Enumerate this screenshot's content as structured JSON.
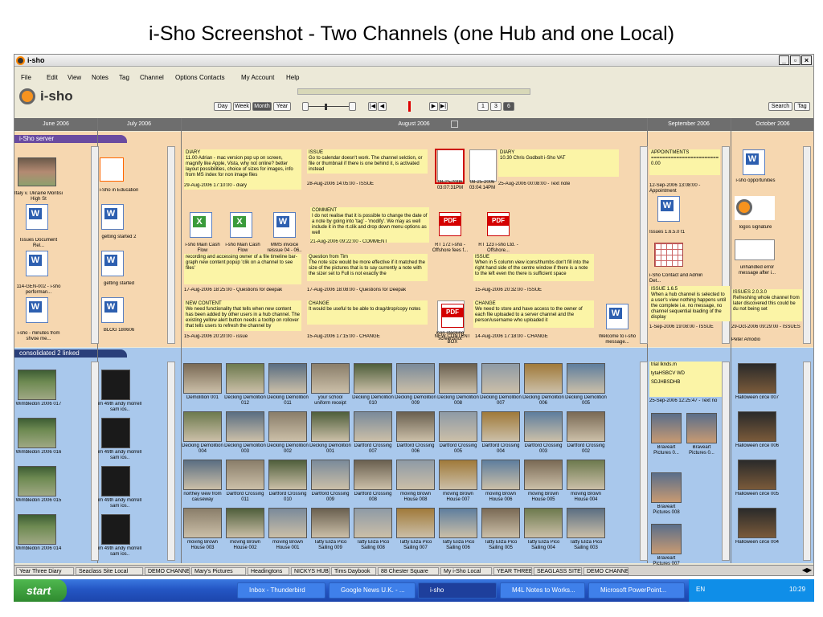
{
  "slide_title": "i-Sho Screenshot -  Two Channels (one Hub and one Local)",
  "window": {
    "title": "i-sho"
  },
  "menu": [
    "File",
    "Edit",
    "View",
    "Notes",
    "Tag",
    "Channel",
    "Options",
    "Contacts",
    "My Account",
    "Help"
  ],
  "toolbar": {
    "logo": "i-sho",
    "view_buttons": [
      "Day",
      "Week",
      "Month",
      "Year"
    ],
    "page_buttons": [
      "1",
      "3",
      "6"
    ],
    "search_label": "Search",
    "tag_label": "Tag"
  },
  "months": [
    "June 2006",
    "July 2006",
    "August 2006",
    "September 2006",
    "October 2006"
  ],
  "top_channel": {
    "name": "i-Sho server",
    "june_items": [
      "Italy v. Ukraine Montisi High St",
      "Issues Document Rel...",
      "114-GEN-002 - i-sho performan...",
      "i-sho - minutes from shvoe me..."
    ],
    "july_items": [
      "i-Sho in Education",
      "getting started 2",
      "getting started",
      "BLOG 180606"
    ],
    "notes": [
      {
        "title": "DIARY",
        "body": "11.00 Adrian - mac version pop up on screen, magnify like Apple, Vista, why not online? better layout possibilities, choice of sizes for images, info from MS index for non image files",
        "footer": "29-Aug-2006 17:10:00 - diary"
      },
      {
        "title": "ISSUE",
        "body": "Go to calendar doesn't work. The channel selction, or file or thumbnail if there is one behind it, is activated instead",
        "footer": "28-Aug-2006 14:05:00 - ISSUE"
      },
      {
        "title": "DIARY",
        "body": "10.30 Chris Godbolt i-Sho VAT",
        "footer": "25-Aug-2006 00:08:00 - Text note"
      },
      {
        "title": "COMMENT",
        "body": "I do not realise that it is possible to change the date of a note by going into 'tag' - 'modify'. We may as well include it in the rt.clik and drop down menu options as well",
        "footer": "21-Aug-2006 09:22:00 - COMMENT"
      },
      {
        "title": "",
        "body": "recording and accessing owner of a file timeline bar-graph new content popup 'clik on a channel to see files'",
        "footer": "17-Aug-2006 18:25:00 - Questions for deepak"
      },
      {
        "title": "Question from Tim",
        "body": "The note size would be more effective if it matched the size of the pictures that is to say currently a note with the sizer set to Full is not exactly the",
        "footer": "17-Aug-2006 18:08:00 - Questions for Deepak"
      },
      {
        "title": "ISSUE",
        "body": "When in 5 column view icons/thumbs don't fill into the right hand side of the centre window if there is a note to the left even tho there is sufficient space",
        "footer": "15-Aug-2006 20:32:00 - ISSUE"
      },
      {
        "title": "NEW CONTENT",
        "body": "We need functionality that tells when new content has been added by other users in a hub channel. The existing yellow alert button needs a tooltip on rollover that tells users to refresh the channel by",
        "footer": "15-Aug-2006 20:20:00 - issue"
      },
      {
        "title": "CHANGE",
        "body": "It would be useful to be able to drag/drop/copy notes",
        "footer": "15-Aug-2006 17:15:00 - CHANGE"
      },
      {
        "title": "CHANGE",
        "body": "We need to store and have access to the owner of each file uploaded to a server channel and the person/username who uploaded it",
        "footer": "14-Aug-2006 17:18:00 - CHANGE"
      }
    ],
    "aug_files": [
      {
        "label": "08-25-2006 03:07:31PM",
        "kind": "shot"
      },
      {
        "label": "08-25-2006 03:04:14PM",
        "kind": "shot"
      },
      {
        "label": "i-sho Main Cash Flow",
        "kind": "xls"
      },
      {
        "label": "i-sho Main Cash Flow",
        "kind": "xls"
      },
      {
        "label": "MMS invoice reissue 04 - 06..",
        "kind": "doc"
      },
      {
        "label": "RT 172 i-sho - Offshore fees f...",
        "kind": "pdf"
      },
      {
        "label": "RT 123 i-sho Ltd. - Offshore...",
        "kind": "pdf"
      },
      {
        "label": "icon stacking screenshot",
        "kind": "shot"
      },
      {
        "label": "NEW CONTENT BOX",
        "kind": "pdf"
      },
      {
        "label": "Welcome to i-sho message...",
        "kind": "doc"
      }
    ],
    "sep_items": {
      "note_title": "APPOINTMENTS",
      "note_line": "===================================",
      "note_val": "0.00",
      "note_footer": "12-Sep-2006 13:08:00 - Appointment",
      "files": [
        "Issues 1.6.5.0 t1",
        "i-Sho Contact and Admin Det..."
      ],
      "issue": "ISSUE 1.6.5",
      "issue_body": "When a hub channel is selected to a user's view nothing happens until the complete i.e. no message, no channel sequential loading of the display",
      "issue_footer": "1-Sep-2006 19:08:00 - ISSUE"
    },
    "oct_items": {
      "files": [
        "i-sho opportunities",
        "logos signature",
        "unhandled error message after i..."
      ],
      "issue": "ISSUES 2.0.3.0",
      "issue_body": "Refreshing whole channel from later discovered this could be du not being set",
      "issue_footer": "29-Oct-2006 09:29:00 - ISSUES",
      "last": "Peter Amodio"
    }
  },
  "bottom_channel": {
    "name": "consolidated 2 linked",
    "june_items": [
      "Wimbledon 2006 017",
      "Wimbledon 2006 016",
      "Wimbledon 2006 015",
      "Wimbledon 2006 014"
    ],
    "july_items": [
      "im 49th andy morrell sam ios..",
      "im 49th andy morrell sam ios..",
      "im 49th andy morrell sam ios..",
      "im 49th andy morrell sam ios.."
    ],
    "aug_photos": [
      "Demolition 001",
      "Decking Demolition 012",
      "Decking Demolition 011",
      "your school uniform receipt",
      "Decking Demolition 010",
      "Decking Demolition 009",
      "Decking Demolition 008",
      "Decking Demolition 007",
      "Decking Demolition 006",
      "Decking Demolition 005",
      "Decking Demolition 004",
      "Decking Demolition 003",
      "Decking Demolition 002",
      "Decking Demolition 001",
      "Dartford Crossing 007",
      "Dartford Crossing 006",
      "Dartford Crossing 005",
      "Dartford Crossing 004",
      "Dartford Crossing 003",
      "Dartford Crossing 002",
      "northey view from causeway",
      "Dartford Crossing 011",
      "Dartford Crossing 010",
      "Dartford Crossing 009",
      "Dartford Crossing 008",
      "moving Brown House 008",
      "moving Brown House 007",
      "moving Brown House 006",
      "moving Brown House 005",
      "moving Brown House 004",
      "moving Brown House 003",
      "moving Brown House 002",
      "moving Brown House 001",
      "Tatty Eliza Pico Sailing 009",
      "Tatty Eliza Pico Sailing 008",
      "Tatty Eliza Pico Sailing 007",
      "Tatty Eliza Pico Sailing 006",
      "Tatty Eliza Pico Sailing 005",
      "Tatty Eliza Pico Sailing 004",
      "Tatty Eliza Pico Sailing 003"
    ],
    "sep_note": [
      "trial lknds.m",
      "tytaHSBCV WD",
      "SDJHBSDHB",
      "25-Sep-2006 12:25:47 - Text no"
    ],
    "sep_photos": [
      "Braveart Pictures 0...",
      "Braveart Pictures 0...",
      "Braveart Pictures 008",
      "Braveart Pictures 007"
    ],
    "oct_photos": [
      "Halloween circe 007",
      "Halloween circe 006",
      "Halloween circe 005",
      "Halloween circe 004"
    ]
  },
  "tabs": [
    "Year Three Diary",
    "Seaclass Site Local",
    "DEMO CHANNEL",
    "Mary's Pictures",
    "Headingtons",
    "NICKYS HUB",
    "Tims Daybook",
    "88 Chester Square",
    "My i-Sho Local",
    "YEAR THREE",
    "SEAGLASS SITE",
    "DEMO CHANNEL"
  ],
  "taskbar": {
    "start": "start",
    "buttons": [
      "Inbox - Thunderbird",
      "Google News U.K. - ...",
      "i-sho",
      "M4L Notes to Works...",
      "Microsoft PowerPoint..."
    ],
    "lang": "EN",
    "clock": "10:29"
  }
}
